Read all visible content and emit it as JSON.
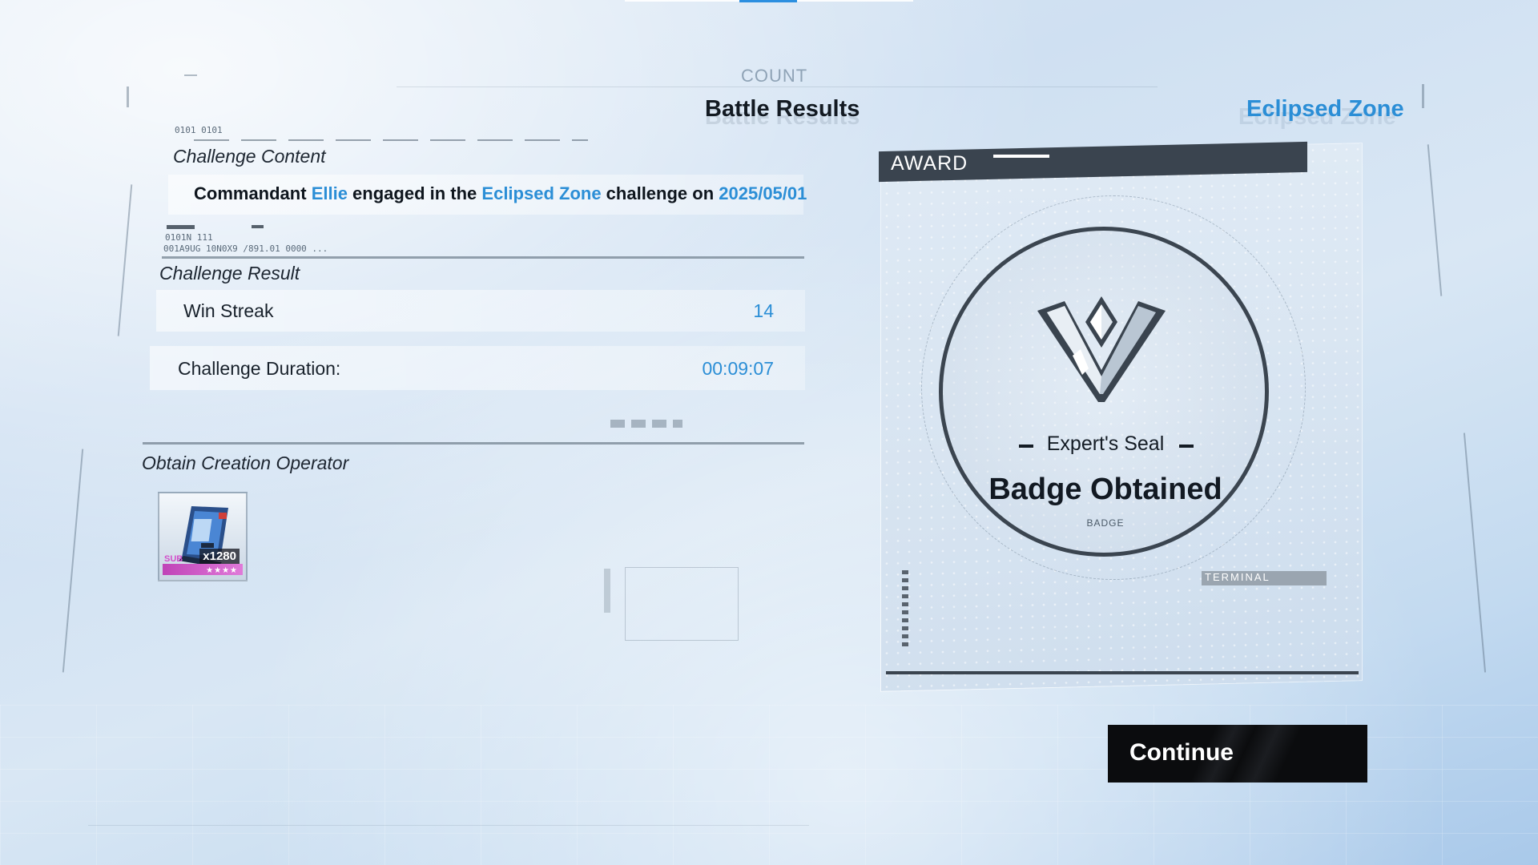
{
  "header": {
    "count_label": "COUNT",
    "title": "Battle Results",
    "zone_title": "Eclipsed Zone"
  },
  "decor": {
    "code_1": "0101 0101",
    "code_2": "0101N 111",
    "code_3": "001A9UG 10N0X9   /891.01   0000 ..."
  },
  "challenge_content": {
    "label": "Challenge Content",
    "sentence": {
      "part1": "Commandant ",
      "name": "Ellie",
      "part2": " engaged in the ",
      "zone": "Eclipsed Zone",
      "part3": " challenge on ",
      "date": "2025/05/01"
    }
  },
  "challenge_result": {
    "label": "Challenge Result",
    "rows": [
      {
        "label": "Win Streak",
        "value": "14"
      },
      {
        "label": "Challenge Duration:",
        "value": "00:09:07"
      }
    ]
  },
  "obtain": {
    "label": "Obtain Creation Operator",
    "item": {
      "quantity": "x1280",
      "stars": "★★★★",
      "tag": "SUB"
    }
  },
  "award": {
    "header": "AWARD",
    "seal_name": "Expert's Seal",
    "title": "Badge Obtained",
    "subtitle": "BADGE",
    "terminal": "TERMINAL"
  },
  "actions": {
    "continue_label": "Continue"
  },
  "colors": {
    "accent": "#2b8ed6",
    "dark": "#0b0c0e",
    "rarity": "#c043b7"
  }
}
